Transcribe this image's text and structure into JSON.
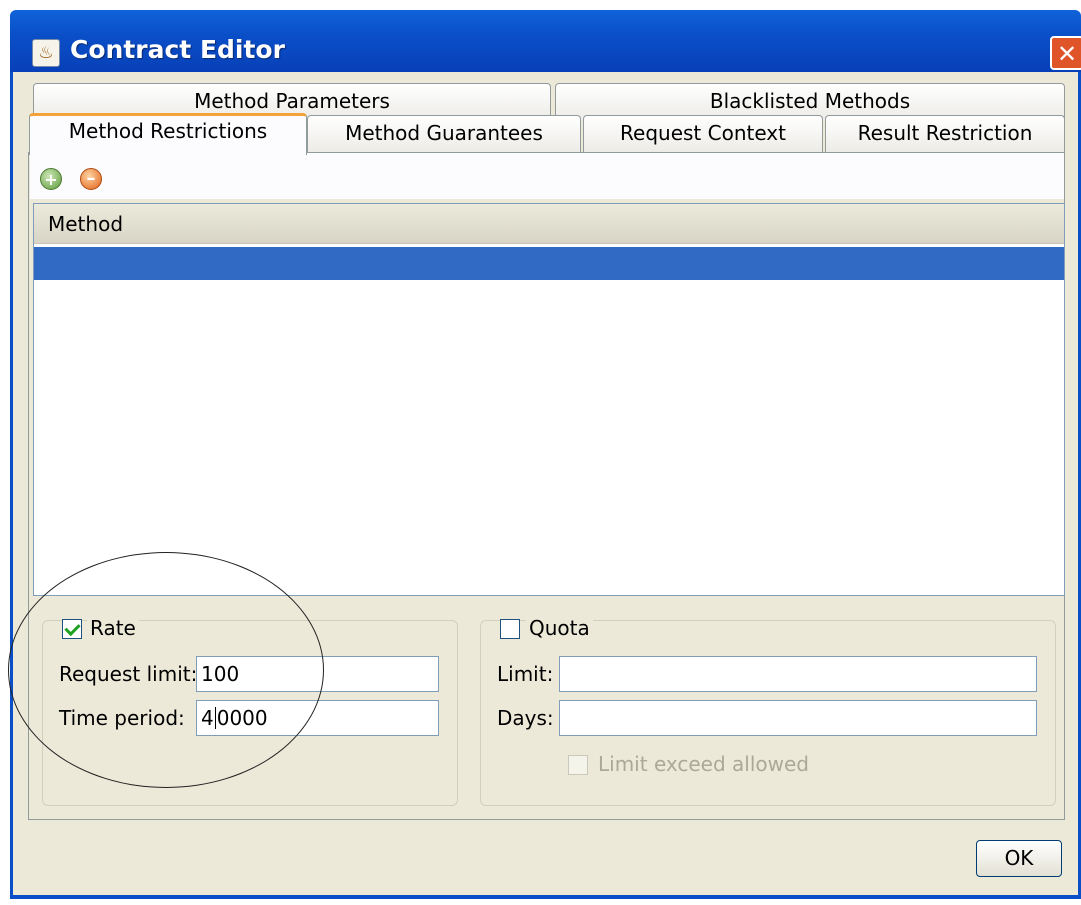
{
  "window": {
    "title": "Contract Editor",
    "close_glyph": "✕"
  },
  "tabs": {
    "row1": [
      "Method Parameters",
      "Blacklisted Methods"
    ],
    "row2": [
      "Method Restrictions",
      "Method Guarantees",
      "Request Context",
      "Result Restriction"
    ],
    "active": "Method Restrictions"
  },
  "toolbar": {
    "add_icon": "add-icon",
    "remove_icon": "remove-icon"
  },
  "table": {
    "columns": [
      "Method"
    ],
    "rows": [
      ""
    ],
    "selected_row_color": "#316ac5"
  },
  "rate": {
    "label": "Rate",
    "checked": true,
    "request_limit_label": "Request limit:",
    "request_limit_value": "100",
    "time_period_label": "Time period:",
    "time_period_before_caret": "4",
    "time_period_after_caret": "0000"
  },
  "quota": {
    "label": "Quota",
    "checked": false,
    "limit_label": "Limit:",
    "limit_value": "",
    "days_label": "Days:",
    "days_value": "",
    "exceed_label": "Limit exceed allowed",
    "exceed_checked": false
  },
  "footer": {
    "ok_label": "OK"
  },
  "colors": {
    "titlebar": "#0a4fc8",
    "dialog_bg": "#ece9d8",
    "active_tab_accent": "#f2a13b"
  }
}
